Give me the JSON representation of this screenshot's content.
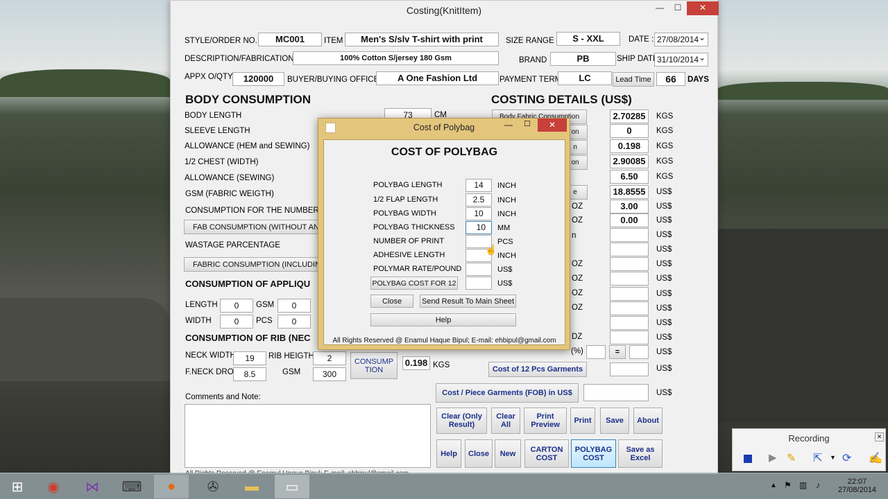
{
  "window": {
    "title": "Costing(KnitItem)"
  },
  "header": {
    "style_label": "STYLE/ORDER NO.",
    "style_value": "MC001",
    "item_label": "ITEM",
    "item_value": "Men's S/slv T-shirt with print",
    "size_label": "SIZE RANGE",
    "size_value": "S - XXL",
    "date_label": "DATE :",
    "date_value": "27/08/2014",
    "desc_label": "DESCRIPTION/FABRICATION",
    "desc_value": "100% Cotton S/jersey 180 Gsm",
    "brand_label": "BRAND",
    "brand_value": "PB",
    "ship_label": "SHIP DATE",
    "ship_value": "31/10/2014",
    "qty_label": "APPX O/QTY",
    "qty_value": "120000",
    "buyer_label": "BUYER/BUYING OFFICE",
    "buyer_value": "A One Fashion Ltd",
    "payment_label": "PAYMENT TERMS",
    "payment_value": "LC",
    "lead_btn": "Lead Time",
    "lead_value": "66",
    "days_label": "DAYS"
  },
  "body": {
    "title": "BODY CONSUMPTION",
    "body_length": "BODY LENGTH",
    "body_length_value": "73",
    "cm": "CM",
    "sleeve": "SLEEVE LENGTH",
    "allowance_hem": "ALLOWANCE (HEM and SEWING)",
    "half_chest": "1/2 CHEST (WIDTH)",
    "allowance_sewing": "ALLOWANCE (SEWING)",
    "gsm": "GSM (FABRIC WEIGTH)",
    "cons_number": "CONSUMPTION FOR THE NUMBER",
    "fab_cons_btn": "FAB CONSUMPTION (WITHOUT ANY W",
    "wastage": "WASTAGE PARCENTAGE",
    "fab_cons2_btn": "FABRIC CONSUMPTION (INCLUDING W"
  },
  "applique": {
    "title": "CONSUMPTION OF APPLIQU",
    "length": "LENGTH",
    "length_value": "0",
    "gsm": "GSM",
    "gsm_value": "0",
    "width": "WIDTH",
    "width_value": "0",
    "pcs": "PCS",
    "pcs_value": "0"
  },
  "rib": {
    "title": "CONSUMPTION OF RIB (NEC",
    "neck_width": "NECK WIDTH",
    "neck_width_value": "19",
    "rib_height": "RIB HEIGTH",
    "rib_height_value": "2",
    "fneck_drop": "F.NECK DROP",
    "fneck_drop_value": "8.5",
    "gsm": "GSM",
    "gsm_value": "300",
    "consumption_btn": "CONSUMP TION",
    "result": "0.198",
    "kgs": "KGS"
  },
  "comments": {
    "label": "Comments and Note:"
  },
  "footer_text": "All Rights Reserved @ Enamul Haque Bipul; E-mail: ehbipul@gmail.com",
  "costing": {
    "title": "COSTING DETAILS (US$)",
    "btn_body_fabric": "Body Fabric Consumption",
    "btn_frag2": "on",
    "btn_frag3": "n",
    "btn_frag4": "on",
    "btn_frag5": "e",
    "values": [
      "2.70285",
      "0",
      "0.198",
      "2.90085",
      "6.50",
      "18.8555",
      "3.00",
      "0.00"
    ],
    "units": [
      "KGS",
      "KGS",
      "KGS",
      "KGS",
      "KGS",
      "US$",
      "US$",
      "US$"
    ],
    "oz1": "OZ",
    "oz2": "OZ",
    "usd": "US$",
    "frag_n": "n",
    "frag_oz1": "OZ",
    "frag_oz2": "OZ",
    "frag_oz3": "OZ",
    "frag_oz4": "OZ",
    "frag_oz5": "DZ",
    "pct": "(%)",
    "eq": "=",
    "cost12_btn": "Cost of 12 Pcs Garments",
    "fob_btn": "Cost / Piece Garments (FOB) in US$"
  },
  "actions": {
    "clear_only": "Clear (Only Result)",
    "clear_all": "Clear All",
    "print_preview": "Print Preview",
    "print": "Print",
    "save": "Save",
    "about": "About",
    "help": "Help",
    "close": "Close",
    "new": "New",
    "carton": "CARTON COST",
    "polybag": "POLYBAG COST",
    "save_excel": "Save as Excel"
  },
  "dialog": {
    "title": "Cost of Polybag",
    "heading": "COST OF POLYBAG",
    "rows": [
      {
        "label": "POLYBAG LENGTH",
        "value": "14",
        "unit": "INCH"
      },
      {
        "label": "1/2 FLAP LENGTH",
        "value": "2.5",
        "unit": "INCH"
      },
      {
        "label": "POLYBAG WIDTH",
        "value": "10",
        "unit": "INCH"
      },
      {
        "label": "POLYBAG THICKNESS",
        "value": "10",
        "unit": "MM"
      },
      {
        "label": "NUMBER OF PRINT",
        "value": "",
        "unit": "PCS"
      },
      {
        "label": "ADHESIVE LENGTH",
        "value": "",
        "unit": "INCH"
      },
      {
        "label": "POLYMAR RATE/POUND",
        "value": "",
        "unit": "US$"
      }
    ],
    "cost_btn": "POLYBAG COST FOR 12",
    "cost_unit": "US$",
    "close_btn": "Close",
    "send_btn": "Send Result To Main Sheet",
    "help_btn": "Help",
    "footer": "All Rights Reserved @ Enamul Haque Bipul; E-mail: ehbipul@gmail.com"
  },
  "recording": {
    "title": "Recording"
  },
  "tray": {
    "time": "22:07",
    "date": "27/08/2014"
  }
}
